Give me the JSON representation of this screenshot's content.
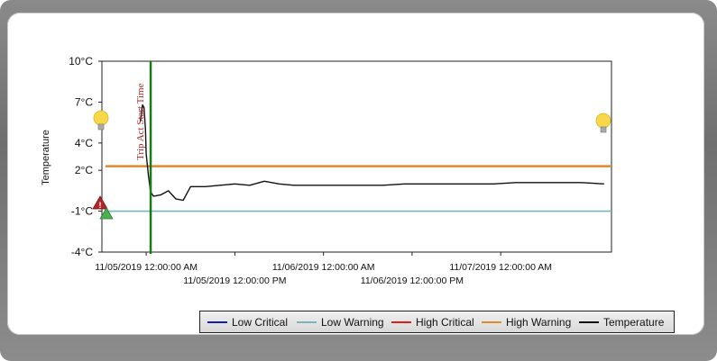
{
  "chart_data": {
    "type": "line",
    "ylabel": "Temperature",
    "ylim": [
      -4,
      10
    ],
    "y_ticks": [
      "10°C",
      "7°C",
      "4°C",
      "2°C",
      "-1°C",
      "-4°C"
    ],
    "y_tick_values": [
      10,
      7,
      4,
      2,
      -1,
      -4
    ],
    "x_ticks_upper": [
      "11/05/2019 12:00:00 AM",
      "11/06/2019 12:00:00 AM",
      "11/07/2019 12:00:00 AM"
    ],
    "x_ticks_lower": [
      "11/05/2019 12:00:00 PM",
      "11/06/2019 12:00:00 PM"
    ],
    "x_range_hours": [
      -6,
      63
    ],
    "annotation": "Trip Act Start Time",
    "annotation_hour": 0.6,
    "series": [
      {
        "name": "Low Critical",
        "color": "#1a1aa8",
        "values": []
      },
      {
        "name": "Low Warning",
        "color": "#79b4b8",
        "values": [
          -1,
          -1
        ]
      },
      {
        "name": "High Critical",
        "color": "#d62020",
        "values": []
      },
      {
        "name": "High Warning",
        "color": "#e08a2c",
        "values": [
          2.3,
          2.3
        ]
      },
      {
        "name": "Temperature",
        "color": "#111111",
        "x": [
          -0.8,
          -0.5,
          -0.3,
          -0.1,
          0.0,
          0.3,
          0.6,
          1.0,
          2.0,
          3.0,
          4.0,
          5.0,
          5.5,
          6.0,
          8.0,
          10.0,
          12.0,
          14.0,
          16.0,
          18.0,
          20.0,
          23.0,
          26.0,
          29.0,
          32.0,
          35.0,
          38.0,
          41.0,
          44.0,
          47.0,
          50.0,
          53.0,
          56.0,
          59.0,
          62.0
        ],
        "values": [
          5.6,
          6.8,
          6.6,
          5.0,
          3.2,
          1.6,
          0.4,
          0.1,
          0.2,
          0.5,
          -0.1,
          -0.2,
          0.3,
          0.8,
          0.8,
          0.9,
          1.0,
          0.9,
          1.2,
          1.0,
          0.9,
          0.9,
          0.9,
          0.9,
          0.9,
          1.0,
          1.0,
          1.0,
          1.0,
          1.0,
          1.1,
          1.1,
          1.1,
          1.1,
          1.0
        ]
      }
    ]
  },
  "legend": {
    "items": [
      "Low Critical",
      "Low Warning",
      "High Critical",
      "High Warning",
      "Temperature"
    ]
  }
}
